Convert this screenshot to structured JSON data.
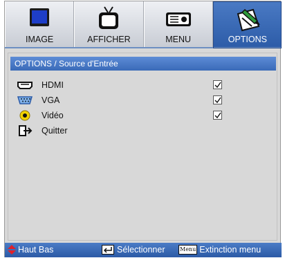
{
  "tabs": [
    {
      "label": "IMAGE",
      "icon": "monitor-icon",
      "active": false
    },
    {
      "label": "AFFICHER",
      "icon": "tv-icon",
      "active": false
    },
    {
      "label": "MENU",
      "icon": "menu-device-icon",
      "active": false
    },
    {
      "label": "OPTIONS",
      "icon": "options-pencil-icon",
      "active": true
    }
  ],
  "panel": {
    "title": "OPTIONS / Source d'Entrée",
    "items": [
      {
        "label": "HDMI",
        "icon": "hdmi-port-icon",
        "checked": true
      },
      {
        "label": "VGA",
        "icon": "vga-port-icon",
        "checked": true
      },
      {
        "label": "Vidéo",
        "icon": "video-rca-icon",
        "checked": true
      },
      {
        "label": "Quitter",
        "icon": "exit-icon",
        "checked": null
      }
    ]
  },
  "footer": {
    "nav_label": "Haut Bas",
    "enter_label": "Sélectionner",
    "menu_key": "Menu",
    "menu_label": "Extinction menu"
  },
  "colors": {
    "accent": "#3a6ab8",
    "panel_bg": "#d8d8d8",
    "footer_arrow": "#e0202a"
  }
}
